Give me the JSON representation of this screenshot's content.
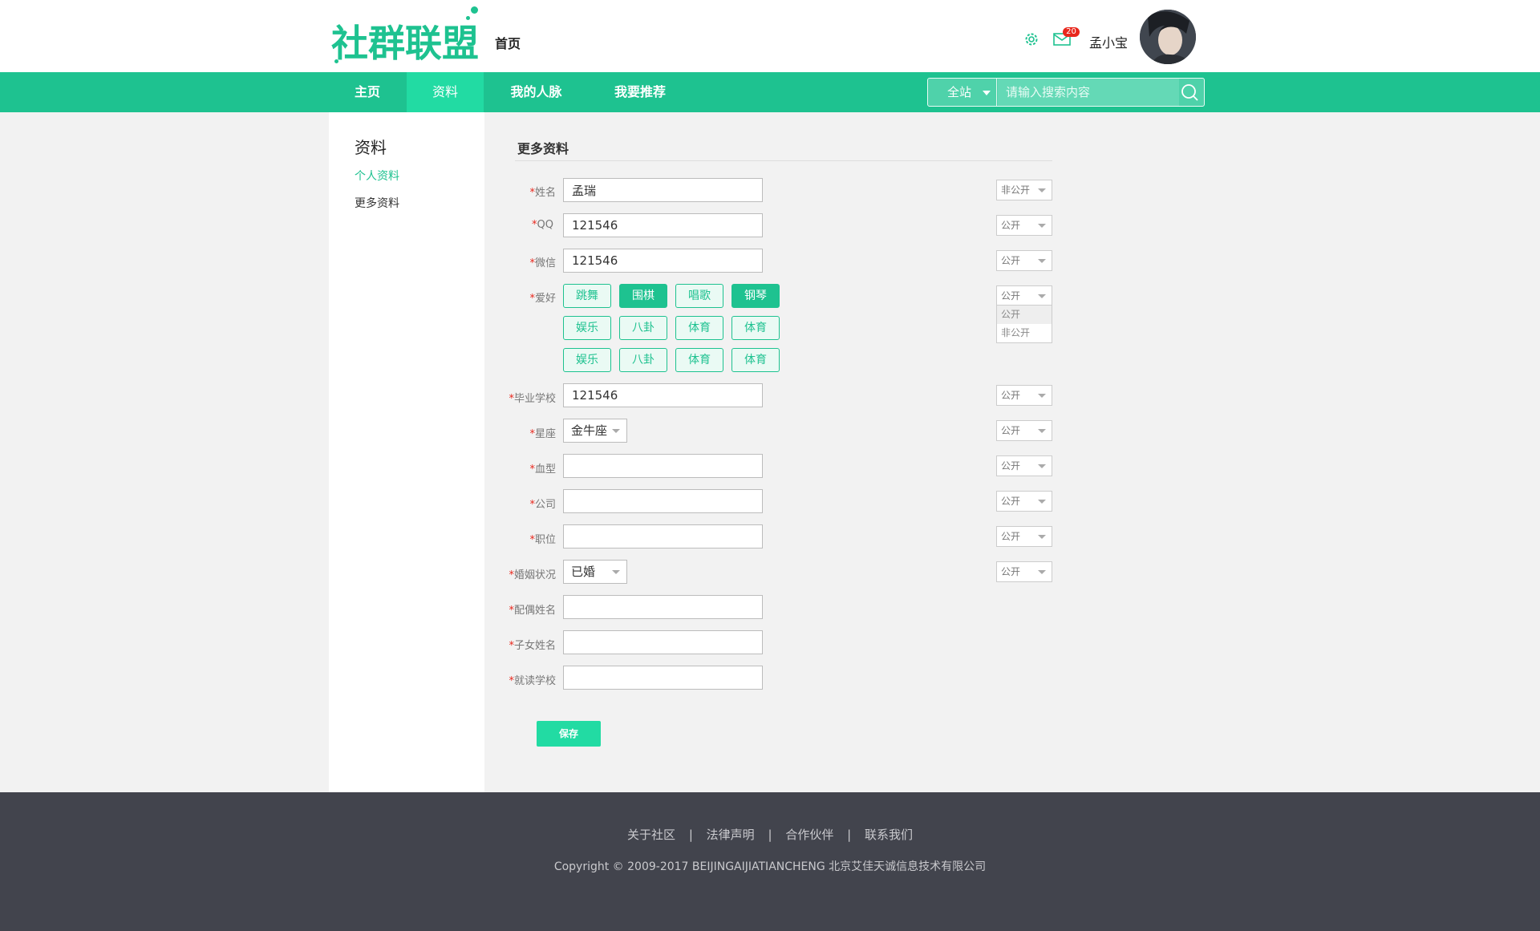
{
  "header": {
    "logo_text": "社群联盟",
    "home_link": "首页",
    "notification_count": "20",
    "username": "孟小宝"
  },
  "nav": {
    "items": [
      {
        "label": "主页",
        "active": false
      },
      {
        "label": "资料",
        "active": true
      },
      {
        "label": "我的人脉",
        "active": false
      },
      {
        "label": "我要推荐",
        "active": false
      }
    ],
    "search_scope": "全站",
    "search_placeholder": "请输入搜索内容"
  },
  "sidebar": {
    "title": "资料",
    "links": [
      {
        "label": "个人资料",
        "active": true
      },
      {
        "label": "更多资料",
        "active": false
      }
    ]
  },
  "form": {
    "title": "更多资料",
    "required_mark": "*",
    "fields": {
      "name": {
        "label": "姓名",
        "value": "孟瑞",
        "visibility": "非公开"
      },
      "qq": {
        "label": "QQ",
        "value": "121546",
        "visibility": "公开"
      },
      "wechat": {
        "label": "微信",
        "value": "121546",
        "visibility": "公开"
      },
      "hobby": {
        "label": "爱好",
        "visibility": "公开"
      },
      "school": {
        "label": "毕业学校",
        "value": "121546",
        "visibility": "公开"
      },
      "zodiac": {
        "label": "星座",
        "value": "金牛座",
        "visibility": "公开"
      },
      "blood": {
        "label": "血型",
        "value": "",
        "visibility": "公开"
      },
      "company": {
        "label": "公司",
        "value": "",
        "visibility": "公开"
      },
      "position": {
        "label": "职位",
        "value": "",
        "visibility": "公开"
      },
      "marital": {
        "label": "婚姻状况",
        "value": "已婚",
        "visibility": "公开"
      },
      "spouse": {
        "label": "配偶姓名",
        "value": ""
      },
      "children": {
        "label": "子女姓名",
        "value": ""
      },
      "children_school": {
        "label": "就读学校",
        "value": ""
      }
    },
    "hobby_tags": [
      {
        "label": "跳舞",
        "selected": false
      },
      {
        "label": "围棋",
        "selected": true
      },
      {
        "label": "唱歌",
        "selected": false
      },
      {
        "label": "钢琴",
        "selected": true
      },
      {
        "label": "娱乐",
        "selected": false
      },
      {
        "label": "八卦",
        "selected": false
      },
      {
        "label": "体育",
        "selected": false
      },
      {
        "label": "体育",
        "selected": false
      },
      {
        "label": "娱乐",
        "selected": false
      },
      {
        "label": "八卦",
        "selected": false
      },
      {
        "label": "体育",
        "selected": false
      },
      {
        "label": "体育",
        "selected": false
      }
    ],
    "visibility_options": [
      "公开",
      "非公开"
    ],
    "save_label": "保存"
  },
  "footer": {
    "links": [
      "关于社区",
      "法律声明",
      "合作伙伴",
      "联系我们"
    ],
    "separator": "|",
    "copyright": "Copyright © 2009-2017 BEIJINGAIJIATIANCHENG 北京艾佳天诚信息技术有限公司"
  },
  "colors": {
    "brand": "#1ec290",
    "nav_active": "#22dba3",
    "footer_bg": "#42444d",
    "required": "#e8271c"
  }
}
